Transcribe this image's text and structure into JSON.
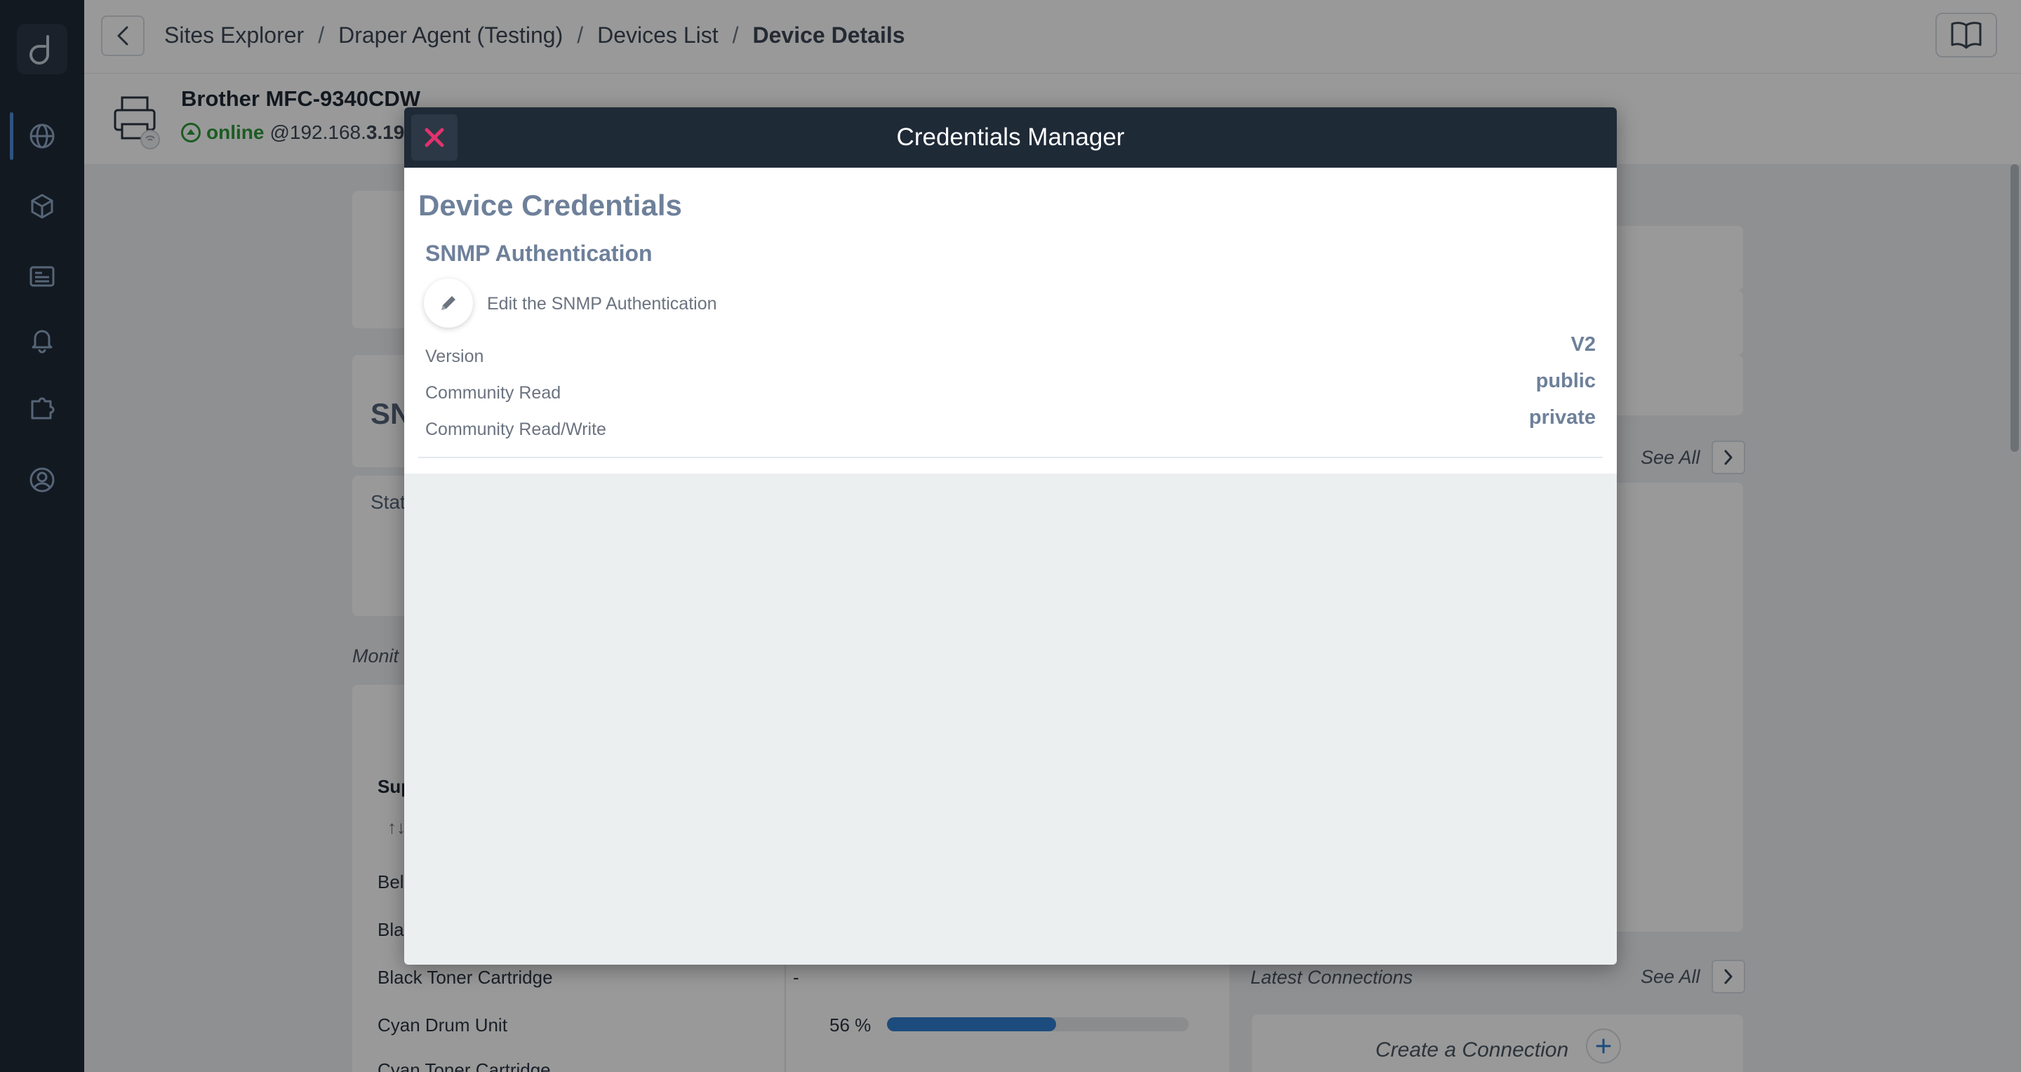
{
  "breadcrumb": {
    "items": [
      "Sites Explorer",
      "Draper Agent (Testing)",
      "Devices List",
      "Device Details"
    ],
    "separator": "/"
  },
  "device": {
    "name": "Brother MFC-9340CDW",
    "status": "online",
    "ip_prefix": "@192.168.",
    "ip_suffix": "3.19"
  },
  "background": {
    "section_prefix": "SN",
    "status_prefix": "Stat",
    "monitor_prefix": "Monit",
    "supplies_prefix": "Sup",
    "sort_glyph": "↑↓",
    "rows": [
      {
        "label": "Bel",
        "value": ""
      },
      {
        "label": "Blac",
        "value": ""
      },
      {
        "label": "Black Toner Cartridge",
        "value": "-"
      },
      {
        "label": "Cyan Drum Unit",
        "value": "56 %",
        "percent": 56
      },
      {
        "label": "Cyan Toner Cartridge",
        "value": ""
      }
    ],
    "see_all": "See All",
    "latest_connections": "Latest Connections",
    "create_connection": "Create a Connection"
  },
  "modal": {
    "title": "Credentials Manager",
    "section_title": "Device Credentials",
    "sub_title": "SNMP Authentication",
    "edit_label": "Edit the SNMP Authentication",
    "fields": [
      {
        "label": "Version",
        "value": "V2"
      },
      {
        "label": "Community Read",
        "value": "public"
      },
      {
        "label": "Community Read/Write",
        "value": "private"
      }
    ]
  },
  "colors": {
    "sidebar": "#1f2a37",
    "accent": "#2f7fd0",
    "online": "#2d9a3a",
    "close": "#e0336e",
    "muted_title": "#6e809a"
  },
  "icons": {
    "logo": "d-logo-icon",
    "back": "chevron-left-icon",
    "book": "book-open-icon",
    "close": "close-icon",
    "edit": "pencil-icon"
  }
}
